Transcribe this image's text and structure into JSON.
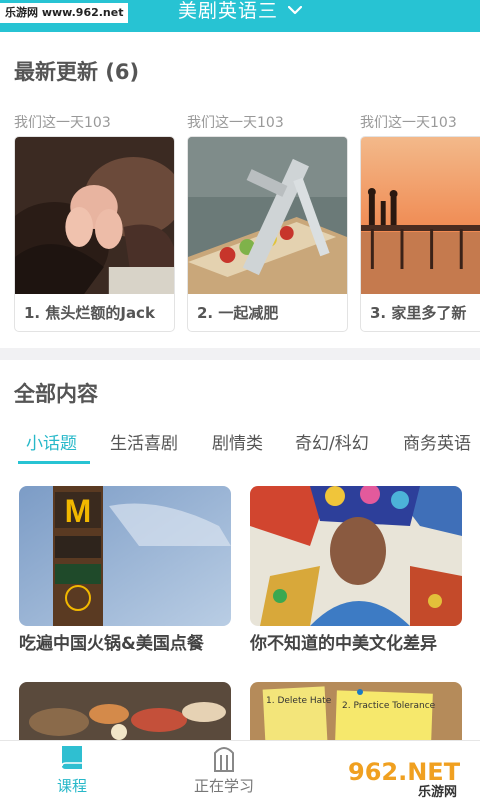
{
  "watermark_top": "乐游网 www.962.net",
  "header": {
    "title": "美剧英语三"
  },
  "latest": {
    "title": "最新更新 (6)",
    "episodes": [
      {
        "meta": "我们这一天103",
        "label": "1. 焦头烂额的Jack"
      },
      {
        "meta": "我们这一天103",
        "label": "2. 一起减肥"
      },
      {
        "meta": "我们这一天103",
        "label": "3. 家里多了新"
      }
    ]
  },
  "all": {
    "title": "全部内容",
    "tabs": [
      "小话题",
      "生活喜剧",
      "剧情类",
      "奇幻/科幻",
      "商务英语"
    ],
    "active_tab": "小话题",
    "cards": [
      {
        "label": "吃遍中国火锅&美国点餐",
        "img_text": "M"
      },
      {
        "label": "你不知道的中美文化差异"
      },
      {
        "label": ""
      },
      {
        "label": "",
        "notes": [
          "1. Delete Hate",
          "2. Practice Tolerance"
        ]
      }
    ]
  },
  "nav": {
    "items": [
      {
        "label": "课程",
        "active": true
      },
      {
        "label": "正在学习",
        "active": false
      }
    ]
  },
  "watermark_br": {
    "brand": "962.NET",
    "sub": "乐游网"
  },
  "colors": {
    "accent": "#27c3d3",
    "accent_text": "#27b8c9"
  }
}
